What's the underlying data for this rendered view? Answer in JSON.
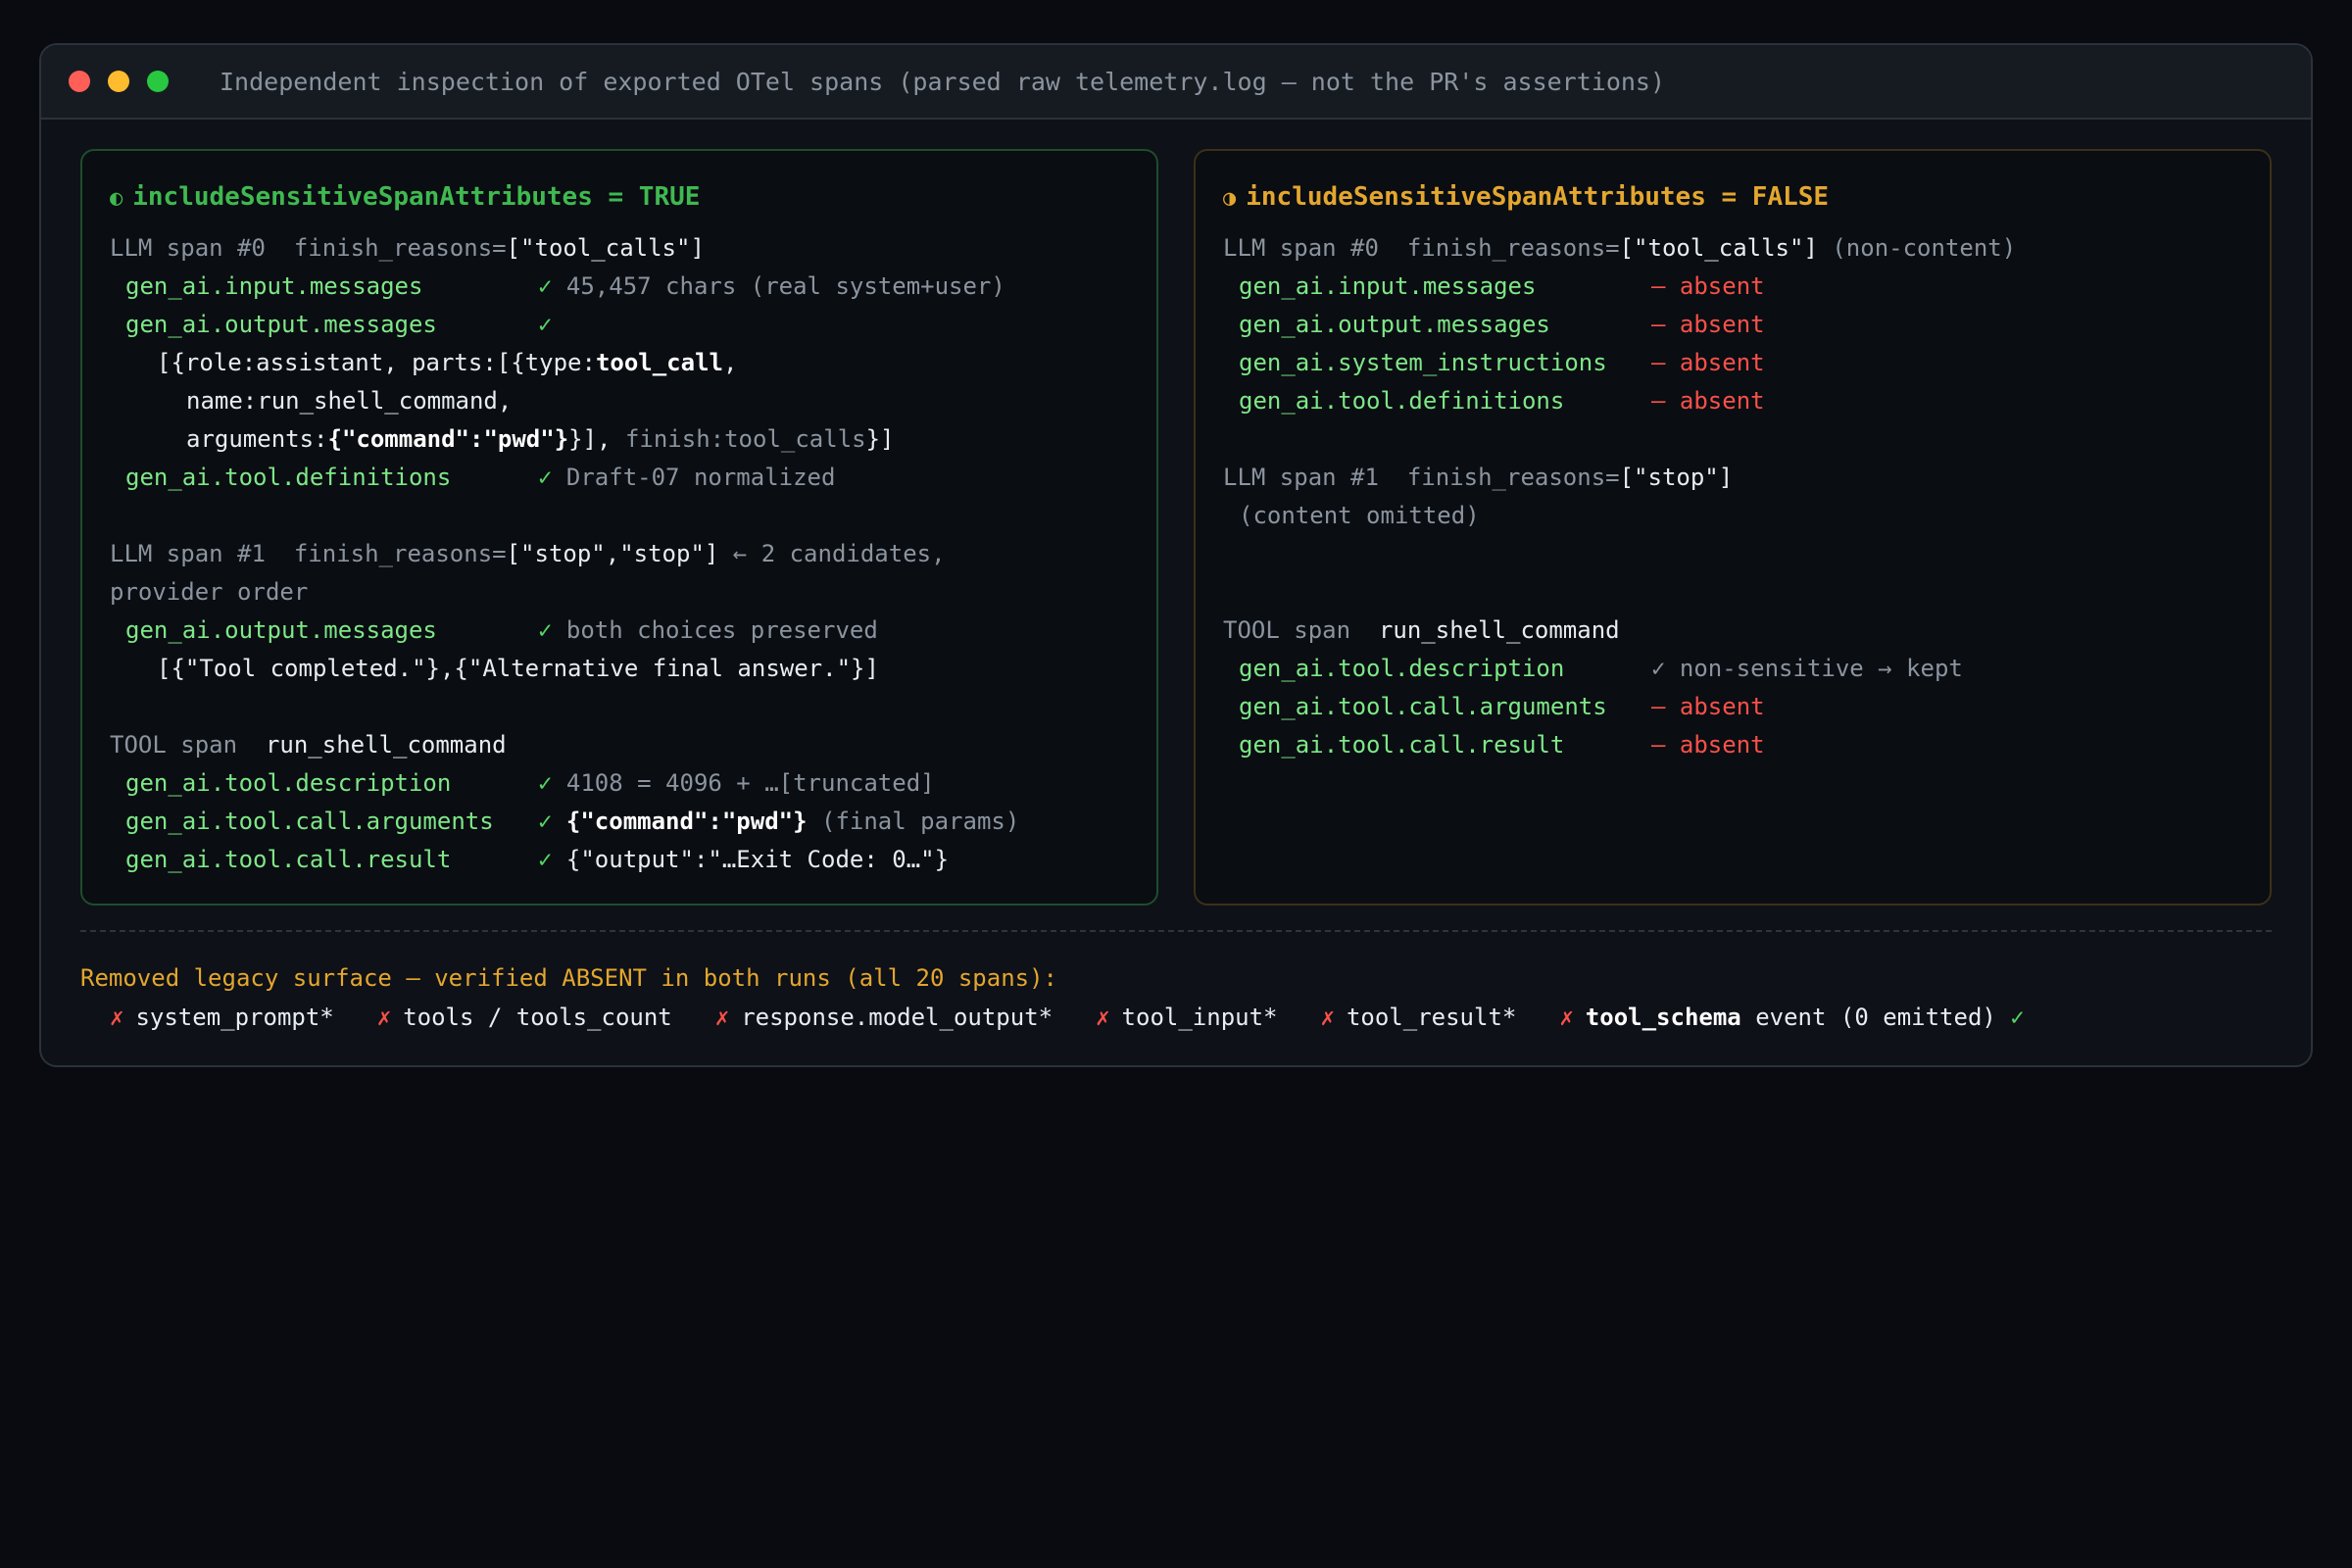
{
  "window": {
    "title": "Independent inspection of exported OTel spans (parsed raw telemetry.log — not the PR's assertions)"
  },
  "left": {
    "heading_glyph": "◐",
    "heading": "includeSensitiveSpanAttributes = TRUE",
    "span0": {
      "label": "LLM span #0",
      "finish_key": "finish_reasons=",
      "finish_val": "[\"tool_calls\"]",
      "input_key": "gen_ai.input.messages",
      "input_check": "✓",
      "input_val": "45,457 chars (real system+user)",
      "output_key": "gen_ai.output.messages",
      "output_check": "✓",
      "out1": "[{role:assistant, parts:[{type:",
      "out1_bold": "tool_call",
      "out1_end": ",",
      "out2": "name:run_shell_command,",
      "out3_a": "arguments:",
      "out3_bold": "{\"command\":\"pwd\"}",
      "out3_b": "}],",
      "out3_gray": " finish:tool_calls",
      "out3_c": "}]",
      "defs_key": "gen_ai.tool.definitions",
      "defs_check": "✓",
      "defs_val": "Draft-07 normalized"
    },
    "span1": {
      "label": "LLM span #1",
      "finish_key": "finish_reasons=",
      "finish_val": "[\"stop\",\"stop\"]",
      "finish_note": " ← 2 candidates,",
      "finish_note2": "provider order",
      "output_key": "gen_ai.output.messages",
      "output_check": "✓",
      "output_val": "both choices preserved",
      "out1": "[{\"Tool completed.\"},{\"Alternative final answer.\"}]"
    },
    "tool": {
      "label": "TOOL span",
      "name": "run_shell_command",
      "desc_key": "gen_ai.tool.description",
      "desc_check": "✓",
      "desc_val": "4108 = 4096 + …[truncated]",
      "args_key": "gen_ai.tool.call.arguments",
      "args_check": "✓",
      "args_bold": "{\"command\":\"pwd\"}",
      "args_note": " (final params)",
      "result_key": "gen_ai.tool.call.result",
      "result_check": "✓",
      "result_val": "{\"output\":\"…Exit Code: 0…\"}"
    }
  },
  "right": {
    "heading_glyph": "◑",
    "heading": "includeSensitiveSpanAttributes = FALSE",
    "span0": {
      "label": "LLM span #0",
      "finish_key": "finish_reasons=",
      "finish_val": "[\"tool_calls\"]",
      "finish_note": " (non-content)",
      "rows": [
        {
          "key": "gen_ai.input.messages",
          "val": "— absent"
        },
        {
          "key": "gen_ai.output.messages",
          "val": "— absent"
        },
        {
          "key": "gen_ai.system_instructions",
          "val": "— absent"
        },
        {
          "key": "gen_ai.tool.definitions",
          "val": "— absent"
        }
      ]
    },
    "span1": {
      "label": "LLM span #1",
      "finish_key": "finish_reasons=",
      "finish_val": "[\"stop\"]",
      "note": "(content omitted)"
    },
    "tool": {
      "label": "TOOL span",
      "name": "run_shell_command",
      "desc_key": "gen_ai.tool.description",
      "desc_val": "✓ non-sensitive → kept",
      "args_key": "gen_ai.tool.call.arguments",
      "args_val": "— absent",
      "result_key": "gen_ai.tool.call.result",
      "result_val": "— absent"
    }
  },
  "legacy": {
    "title": "Removed legacy surface — verified ABSENT in both runs (all 20 spans):",
    "mark": "✗",
    "items": [
      "system_prompt*",
      "tools / tools_count",
      "response.model_output*",
      "tool_input*",
      "tool_result*"
    ],
    "last_bold": "tool_schema",
    "last_rest": " event (0 emitted) ",
    "last_check": "✓"
  },
  "colors": {
    "green": "#3fb950",
    "amber": "#e3a62f",
    "red": "#f85149",
    "key": "#7ee787"
  }
}
